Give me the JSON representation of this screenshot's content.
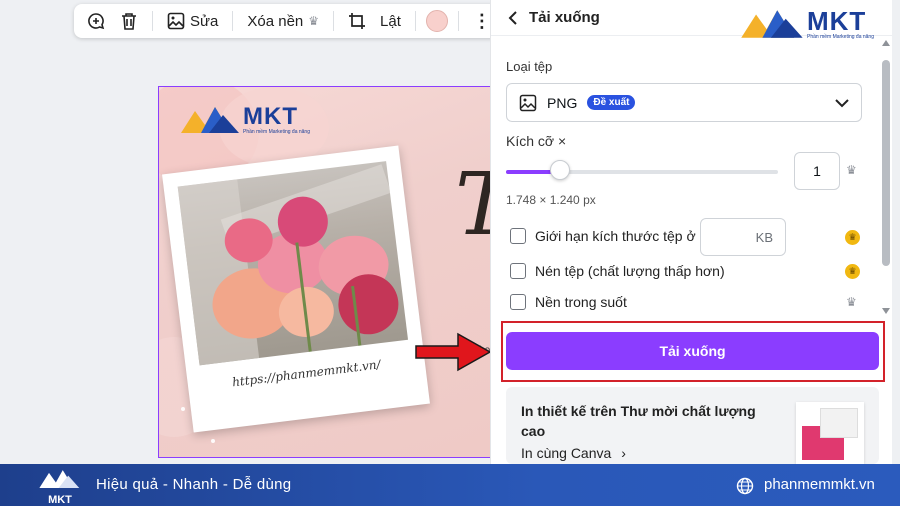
{
  "toolbar": {
    "edit_label": "Sửa",
    "remove_bg_label": "Xóa nền",
    "flip_label": "Lật",
    "color_swatch": "#f8d0cc"
  },
  "design": {
    "logo_text": "MKT",
    "logo_tagline": "Phần mềm Marketing đa năng",
    "big_letter": "T",
    "photo_url": "https://phanmemmkt.vn/",
    "cut_text": "Tho"
  },
  "panel": {
    "title": "Tải xuống",
    "file_type_label": "Loại tệp",
    "file_type_value": "PNG",
    "file_type_badge": "Đề xuất",
    "size_label": "Kích cỡ ×",
    "size_value": "1",
    "size_slider_fraction": 0.2,
    "dimensions": "1.748 × 1.240 px",
    "options": [
      {
        "label": "Giới hạn kích thước tệp ở",
        "checked": false
      },
      {
        "label": "Nén tệp (chất lượng thấp hơn)",
        "checked": false
      },
      {
        "label": "Nền trong suốt",
        "checked": false
      }
    ],
    "kb_unit": "KB",
    "download_button": "Tải xuống",
    "print_title": "In thiết kế trên Thư mời chất lượng cao",
    "print_link": "In cùng Canva",
    "accent_color": "#8b3dff",
    "highlight_color": "#d3222a"
  },
  "header_logo": {
    "text": "MKT",
    "tagline": "Phần mềm Marketing đa năng"
  },
  "bottom_bar": {
    "logo_text": "MKT",
    "slogan": "Hiệu quả - Nhanh - Dễ dùng",
    "website": "phanmemmkt.vn"
  }
}
